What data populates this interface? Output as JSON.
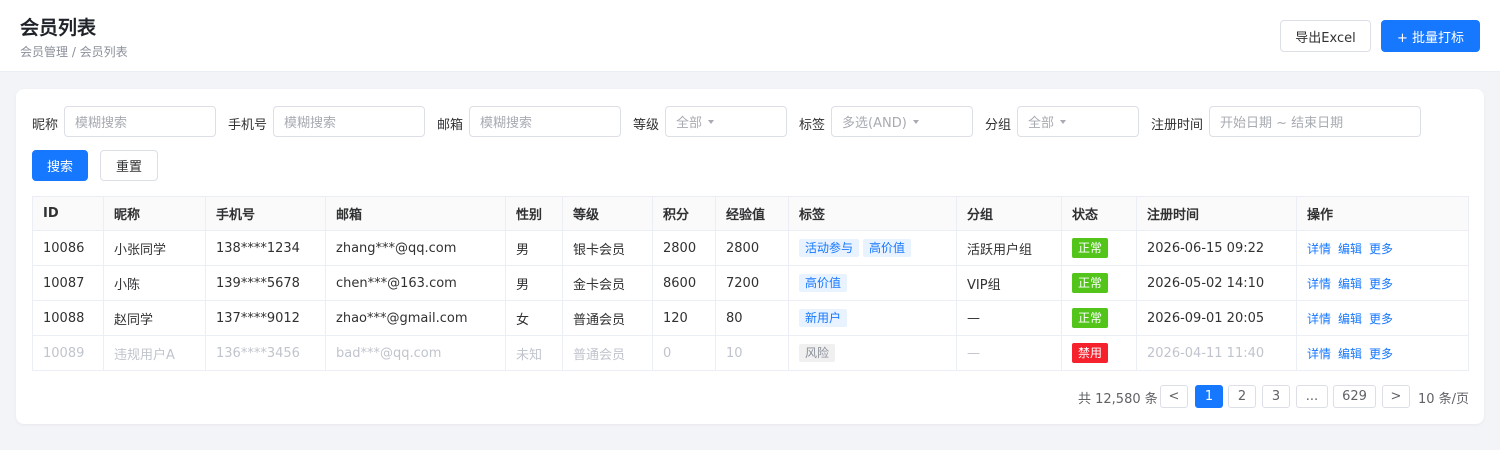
{
  "header": {
    "title": "会员列表",
    "breadcrumb": "会员管理 / 会员列表",
    "export_label": "导出Excel",
    "bulk_tag_label": "+ 批量打标"
  },
  "filters": {
    "nickname": {
      "label": "昵称",
      "placeholder": "模糊搜索"
    },
    "phone": {
      "label": "手机号",
      "placeholder": "模糊搜索"
    },
    "email": {
      "label": "邮箱",
      "placeholder": "模糊搜索"
    },
    "level": {
      "label": "等级",
      "value": "全部"
    },
    "tags": {
      "label": "标签",
      "value": "多选(AND)"
    },
    "group": {
      "label": "分组",
      "value": "全部"
    },
    "reg_time": {
      "label": "注册时间",
      "placeholder": "开始日期 ~ 结束日期"
    },
    "search_label": "搜索",
    "reset_label": "重置"
  },
  "table": {
    "columns": [
      "ID",
      "昵称",
      "手机号",
      "邮箱",
      "性别",
      "等级",
      "积分",
      "经验值",
      "标签",
      "分组",
      "状态",
      "注册时间",
      "操作"
    ],
    "actions": [
      "详情",
      "编辑",
      "更多"
    ],
    "rows": [
      {
        "id": "10086",
        "nickname": "小张同学",
        "phone": "138****1234",
        "email": "zhang***@qq.com",
        "gender": "男",
        "level": "银卡会员",
        "points": "2800",
        "exp": "2800",
        "tags": [
          "活动参与",
          "高价值"
        ],
        "group": "活跃用户组",
        "status": "正常",
        "reg_time": "2026-06-15 09:22"
      },
      {
        "id": "10087",
        "nickname": "小陈",
        "phone": "139****5678",
        "email": "chen***@163.com",
        "gender": "男",
        "level": "金卡会员",
        "points": "8600",
        "exp": "7200",
        "tags": [
          "高价值"
        ],
        "group": "VIP组",
        "status": "正常",
        "reg_time": "2026-05-02 14:10"
      },
      {
        "id": "10088",
        "nickname": "赵同学",
        "phone": "137****9012",
        "email": "zhao***@gmail.com",
        "gender": "女",
        "level": "普通会员",
        "points": "120",
        "exp": "80",
        "tags": [
          "新用户"
        ],
        "group": "—",
        "status": "正常",
        "reg_time": "2026-09-01 20:05"
      },
      {
        "id": "10089",
        "nickname": "违规用户A",
        "phone": "136****3456",
        "email": "bad***@qq.com",
        "gender": "未知",
        "level": "普通会员",
        "points": "0",
        "exp": "10",
        "tags": [
          "风险"
        ],
        "group": "—",
        "status": "禁用",
        "reg_time": "2026-04-11 11:40"
      }
    ]
  },
  "pagination": {
    "total_text": "共 12,580 条",
    "prev": "<",
    "next": ">",
    "pages": [
      "1",
      "2",
      "3",
      "...",
      "629"
    ],
    "current": "1",
    "page_size": "10 条/页"
  },
  "colors": {
    "primary": "#1677ff",
    "status_normal": "#52c41a",
    "status_banned": "#f5222d"
  }
}
